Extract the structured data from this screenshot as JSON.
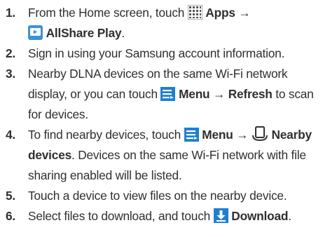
{
  "steps": [
    {
      "num": "1.",
      "t1": "From the Home screen, touch ",
      "apps": "Apps",
      "arrow": " → ",
      "allshare": "AllShare Play",
      "end": "."
    },
    {
      "num": "2.",
      "text": "Sign in using your Samsung account information."
    },
    {
      "num": "3.",
      "t1": "Nearby DLNA devices on the same Wi-Fi network display, or you can touch ",
      "menu": "Menu",
      "arrow": " → ",
      "refresh": "Refresh",
      "t2": " to scan for devices."
    },
    {
      "num": "4.",
      "t1": "To find nearby devices, touch ",
      "menu": "Menu",
      "arrow": " → ",
      "nearby": "Nearby devices",
      "t2": ". Devices on the same Wi-Fi network with file sharing enabled will be listed."
    },
    {
      "num": "5.",
      "text": "Touch a device to view files on the nearby device."
    },
    {
      "num": "6.",
      "t1": "Select files to download, and touch ",
      "download": "Download",
      "end": "."
    }
  ],
  "icons": {
    "apps": "apps-grid-icon",
    "allshare": "allshare-play-icon",
    "menu": "menu-icon",
    "nearby": "nearby-devices-icon",
    "download": "download-icon"
  },
  "colors": {
    "text": "#2f2f2f",
    "icon_blue": "#1f7fd0",
    "allshare_blue": "#3a93da"
  }
}
